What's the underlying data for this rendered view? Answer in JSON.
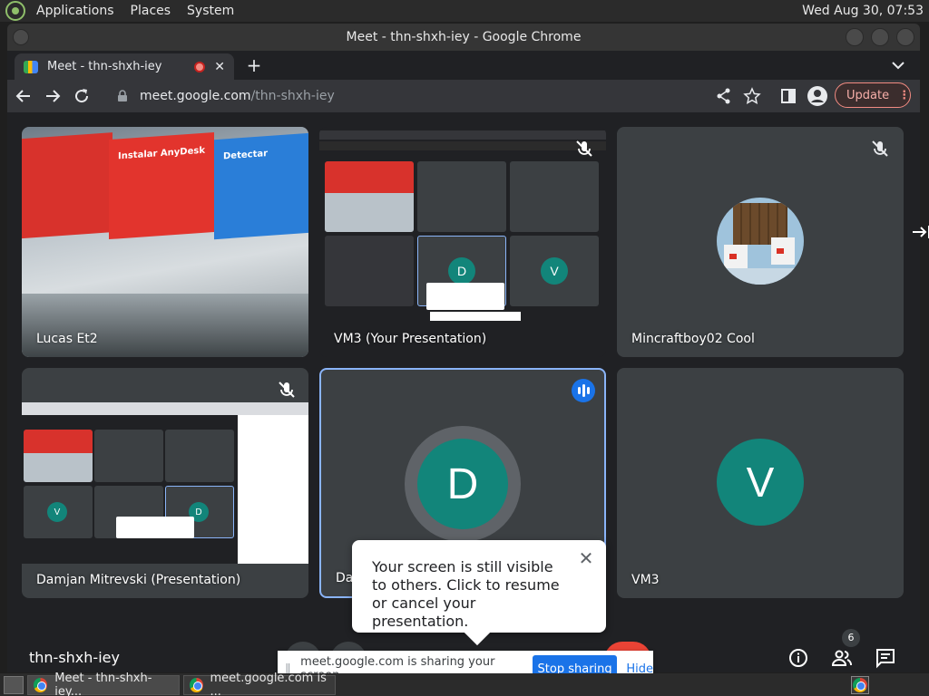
{
  "panel": {
    "menus": [
      "Applications",
      "Places",
      "System"
    ],
    "clock": "Wed Aug 30, 07:53"
  },
  "window": {
    "title": "Meet - thn-shxh-iey - Google Chrome"
  },
  "tab": {
    "title": "Meet - thn-shxh-iey",
    "new_tab": "+"
  },
  "address": {
    "host": "meet.google.com",
    "path": "/thn-shxh-iey"
  },
  "toolbar": {
    "update_label": "Update"
  },
  "tiles": [
    {
      "name": "Lucas Et2"
    },
    {
      "name": "VM3 (Your Presentation)"
    },
    {
      "name": "Mincraftboy02 Cool"
    },
    {
      "name": "Damjan Mitrevski (Presentation)"
    },
    {
      "name": "Da",
      "initial": "D"
    },
    {
      "name": "VM3",
      "initial": "V"
    }
  ],
  "photo_cards": [
    "Instalar AnyDesk",
    "Detectar"
  ],
  "popup": {
    "message": "Your screen is still visible to others. Click to resume or cancel your presentation."
  },
  "meeting_code": "thn-shxh-iey",
  "share_banner": {
    "message": "meet.google.com is sharing your screen.",
    "stop_label": "Stop sharing",
    "hide_label": "Hide"
  },
  "people_count": "6",
  "taskbar": {
    "tasks": [
      "Meet - thn-shxh-iey...",
      "meet.google.com is ..."
    ]
  },
  "colors": {
    "accent": "#1a73e8",
    "avatar": "#12857a",
    "tile": "#3c4043",
    "background": "#202124"
  }
}
